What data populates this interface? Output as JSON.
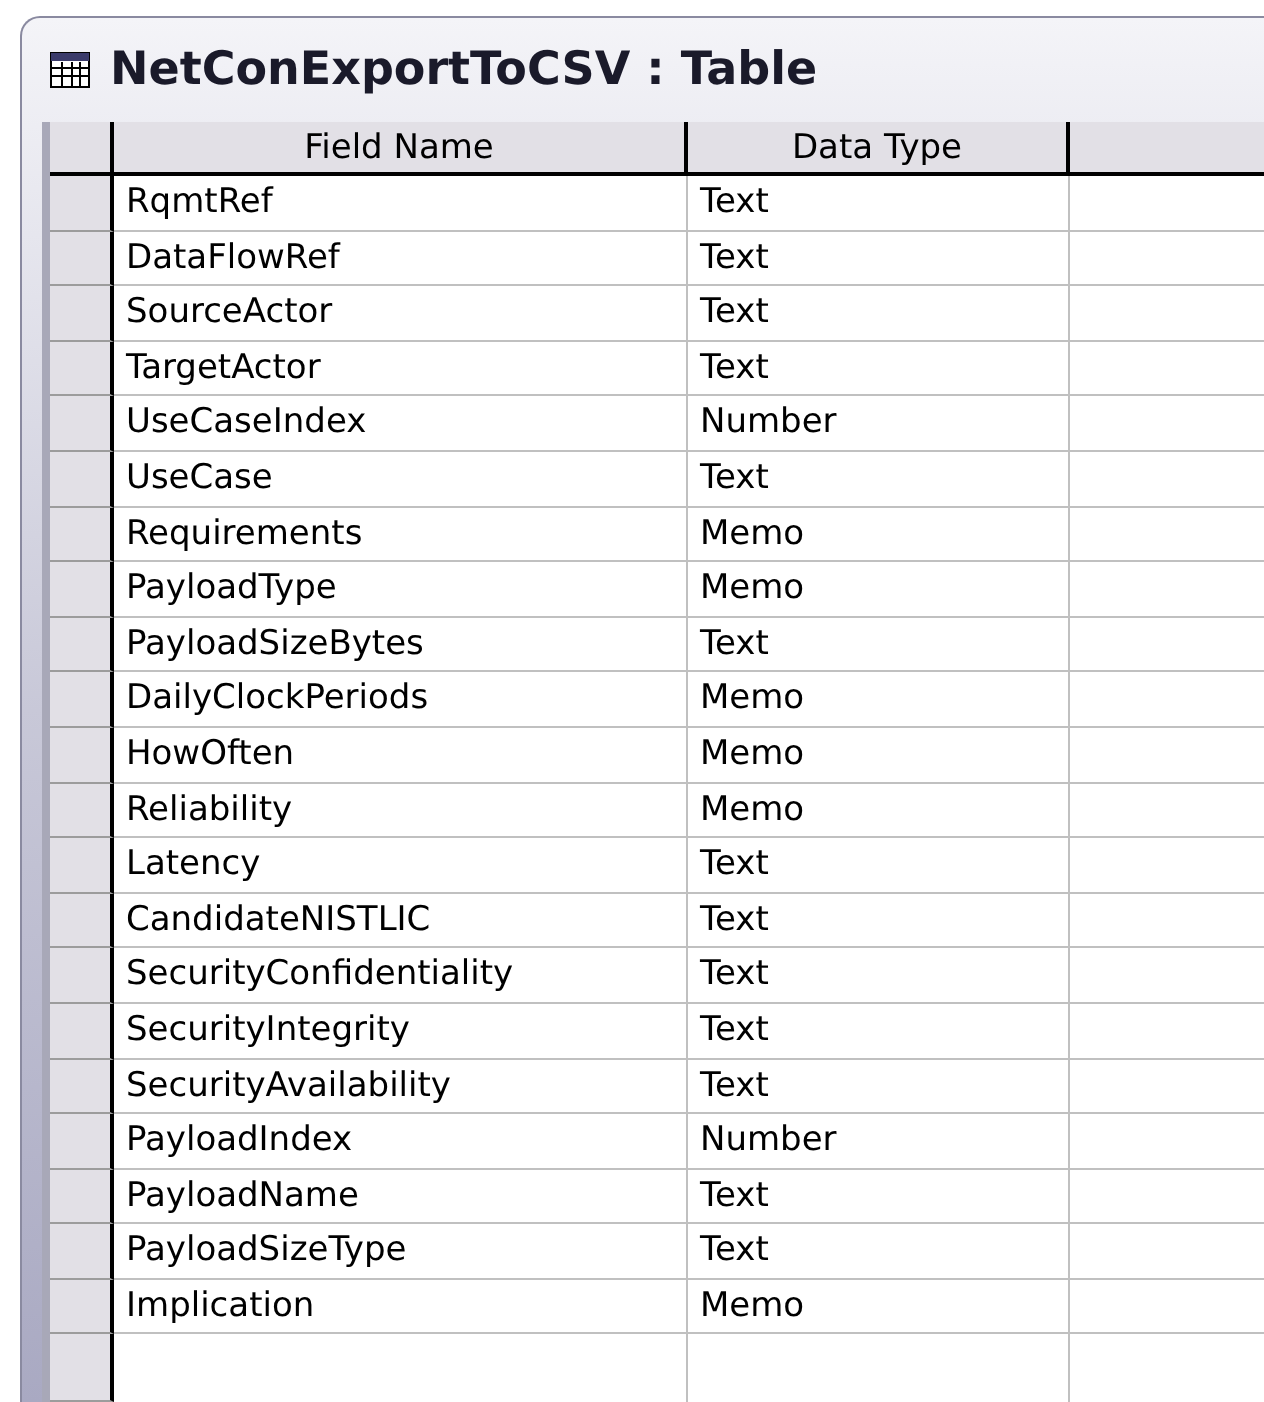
{
  "window": {
    "title": "NetConExportToCSV : Table"
  },
  "table": {
    "columns": [
      "Field Name",
      "Data Type"
    ],
    "rows": [
      {
        "field_name": "RqmtRef",
        "data_type": "Text"
      },
      {
        "field_name": "DataFlowRef",
        "data_type": "Text"
      },
      {
        "field_name": "SourceActor",
        "data_type": "Text"
      },
      {
        "field_name": "TargetActor",
        "data_type": "Text"
      },
      {
        "field_name": "UseCaseIndex",
        "data_type": "Number"
      },
      {
        "field_name": "UseCase",
        "data_type": "Text"
      },
      {
        "field_name": "Requirements",
        "data_type": "Memo"
      },
      {
        "field_name": "PayloadType",
        "data_type": "Memo"
      },
      {
        "field_name": "PayloadSizeBytes",
        "data_type": "Text"
      },
      {
        "field_name": "DailyClockPeriods",
        "data_type": "Memo"
      },
      {
        "field_name": "HowOften",
        "data_type": "Memo"
      },
      {
        "field_name": "Reliability",
        "data_type": "Memo"
      },
      {
        "field_name": "Latency",
        "data_type": "Text"
      },
      {
        "field_name": "CandidateNISTLIC",
        "data_type": "Text"
      },
      {
        "field_name": "SecurityConfidentiality",
        "data_type": "Text"
      },
      {
        "field_name": "SecurityIntegrity",
        "data_type": "Text"
      },
      {
        "field_name": "SecurityAvailability",
        "data_type": "Text"
      },
      {
        "field_name": "PayloadIndex",
        "data_type": "Number"
      },
      {
        "field_name": "PayloadName",
        "data_type": "Text"
      },
      {
        "field_name": "PayloadSizeType",
        "data_type": "Text"
      },
      {
        "field_name": "Implication",
        "data_type": "Memo"
      }
    ]
  }
}
